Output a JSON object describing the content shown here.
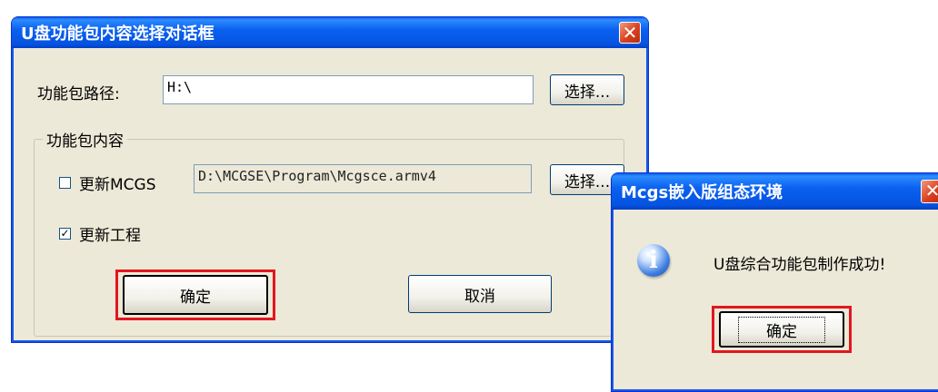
{
  "main_dialog": {
    "title": "U盘功能包内容选择对话框",
    "close_glyph": "✕",
    "path_label": "功能包路径:",
    "path_value": "H:\\",
    "select_path_button": "选择...",
    "group_title": "功能包内容",
    "update_mcgs": {
      "label": "更新MCGS",
      "checked": false,
      "path_value": "D:\\MCGSE\\Program\\Mcgsce.armv4",
      "select_button": "选择..."
    },
    "update_project": {
      "label": "更新工程",
      "checked": true,
      "check_glyph": "✓"
    },
    "ok_button": "确定",
    "cancel_button": "取消"
  },
  "message_box": {
    "title": "Mcgs嵌入版组态环境",
    "close_glyph": "✕",
    "icon": "info-icon",
    "icon_glyph": "i",
    "message": "U盘综合功能包制作成功!",
    "ok_button": "确定"
  },
  "colors": {
    "highlight_frame": "#e3161f",
    "titlebar": "#0553e0",
    "dialog_bg": "#ece9d8"
  }
}
